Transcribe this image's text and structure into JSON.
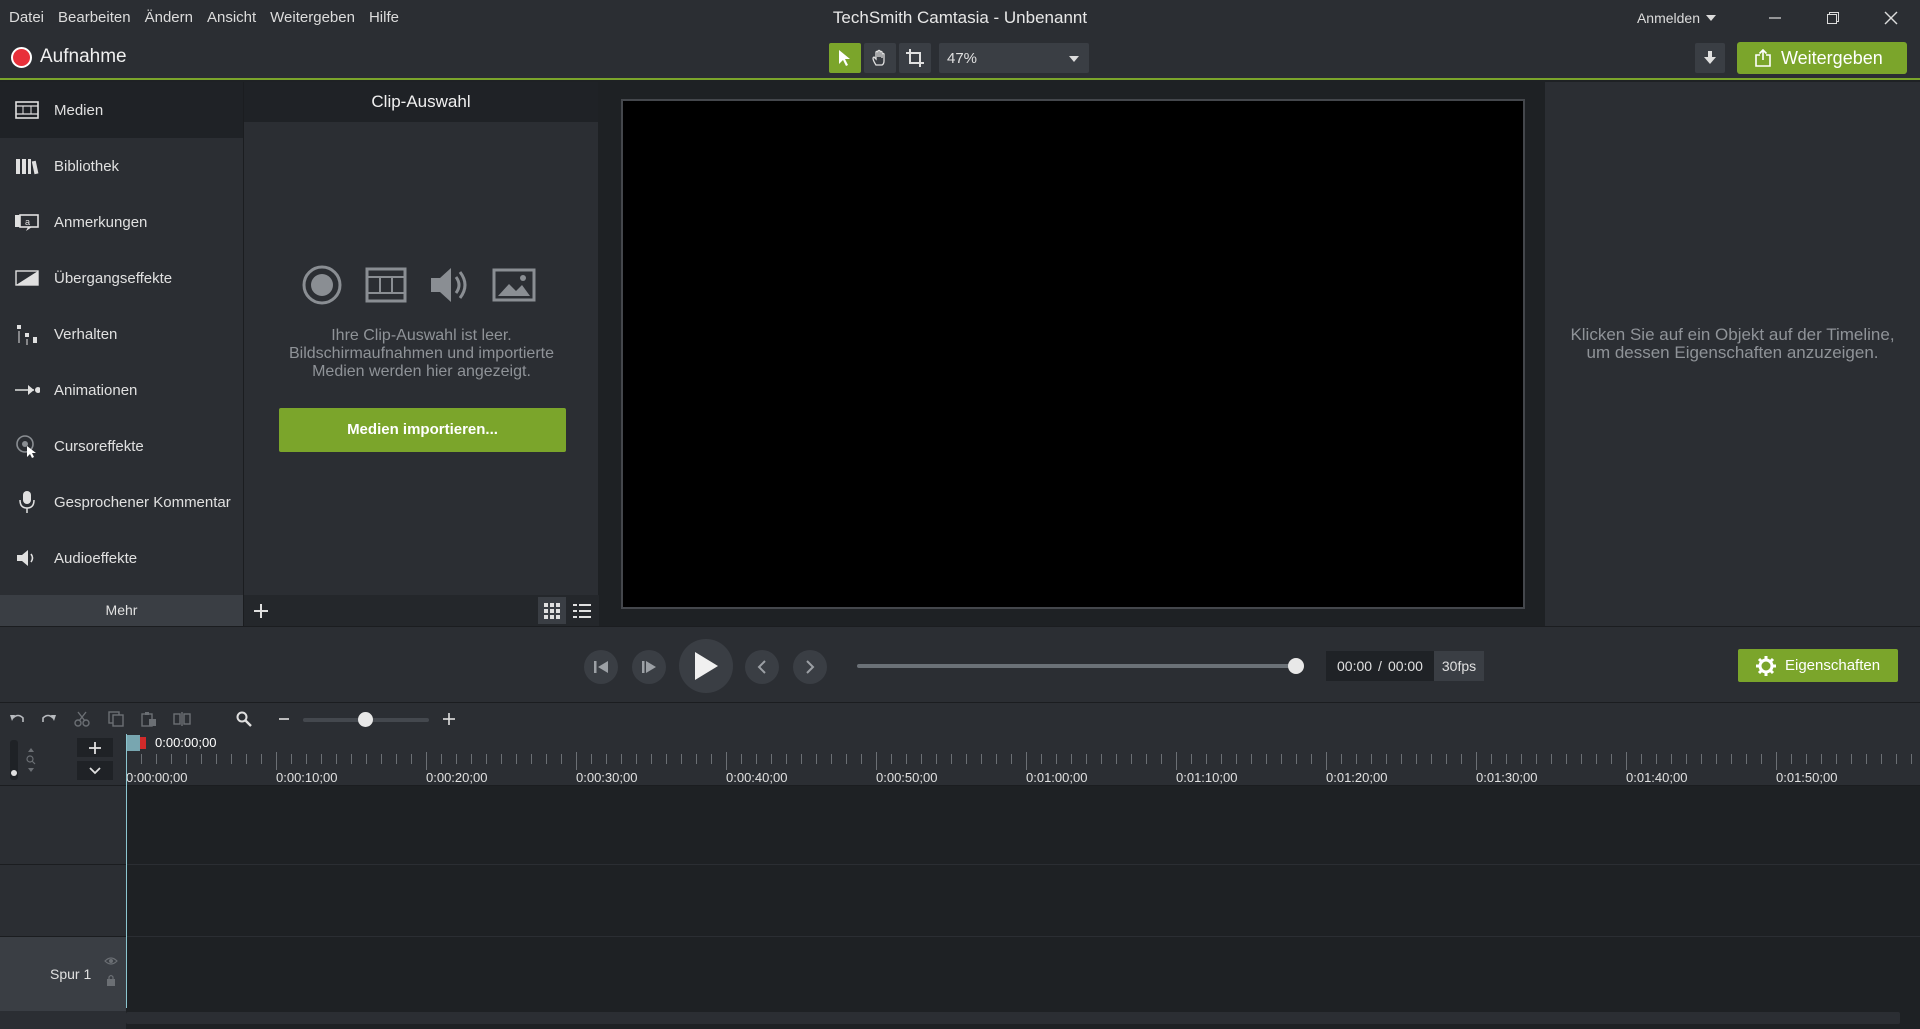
{
  "menu": [
    "Datei",
    "Bearbeiten",
    "Ändern",
    "Ansicht",
    "Weitergeben",
    "Hilfe"
  ],
  "window": {
    "title": "TechSmith Camtasia - Unbenannt",
    "login": "Anmelden"
  },
  "toolbar": {
    "record_label": "Aufnahme",
    "zoom": "47%",
    "share_label": "Weitergeben",
    "accent": "#7ba52b",
    "record_color": "#e8303a"
  },
  "sidebar": {
    "items": [
      {
        "label": "Medien",
        "icon": "film-strip-icon"
      },
      {
        "label": "Bibliothek",
        "icon": "library-books-icon"
      },
      {
        "label": "Anmerkungen",
        "icon": "callout-icon"
      },
      {
        "label": "Übergangseffekte",
        "icon": "transition-icon"
      },
      {
        "label": "Verhalten",
        "icon": "behavior-icon"
      },
      {
        "label": "Animationen",
        "icon": "animation-arrow-icon"
      },
      {
        "label": "Cursoreffekte",
        "icon": "cursor-effect-icon"
      },
      {
        "label": "Gesprochener Kommentar",
        "icon": "microphone-icon"
      },
      {
        "label": "Audioeffekte",
        "icon": "speaker-icon"
      }
    ],
    "more_label": "Mehr"
  },
  "clip_bin": {
    "title": "Clip-Auswahl",
    "empty_message": "Ihre Clip-Auswahl ist leer. Bildschirmaufnahmen und importierte Medien werden hier angezeigt.",
    "import_label": "Medien importieren..."
  },
  "properties": {
    "hint": "Klicken Sie auf ein Objekt auf der Timeline, um dessen Eigenschaften anzuzeigen.",
    "button_label": "Eigenschaften"
  },
  "playback": {
    "current_time": "00:00",
    "separator": "/",
    "total_time": "00:00",
    "fps": "30fps",
    "progress": 1.0
  },
  "timeline": {
    "playhead_time": "0:00:00;00",
    "ruler": [
      "0:00:00;00",
      "0:00:10;00",
      "0:00:20;00",
      "0:00:30;00",
      "0:00:40;00",
      "0:00:50;00",
      "0:01:00;00",
      "0:01:10;00",
      "0:01:20;00",
      "0:01:30;00",
      "0:01:40;00",
      "0:01:50;00"
    ],
    "track_label": "Spur 1",
    "zoom_level": 0.45
  }
}
